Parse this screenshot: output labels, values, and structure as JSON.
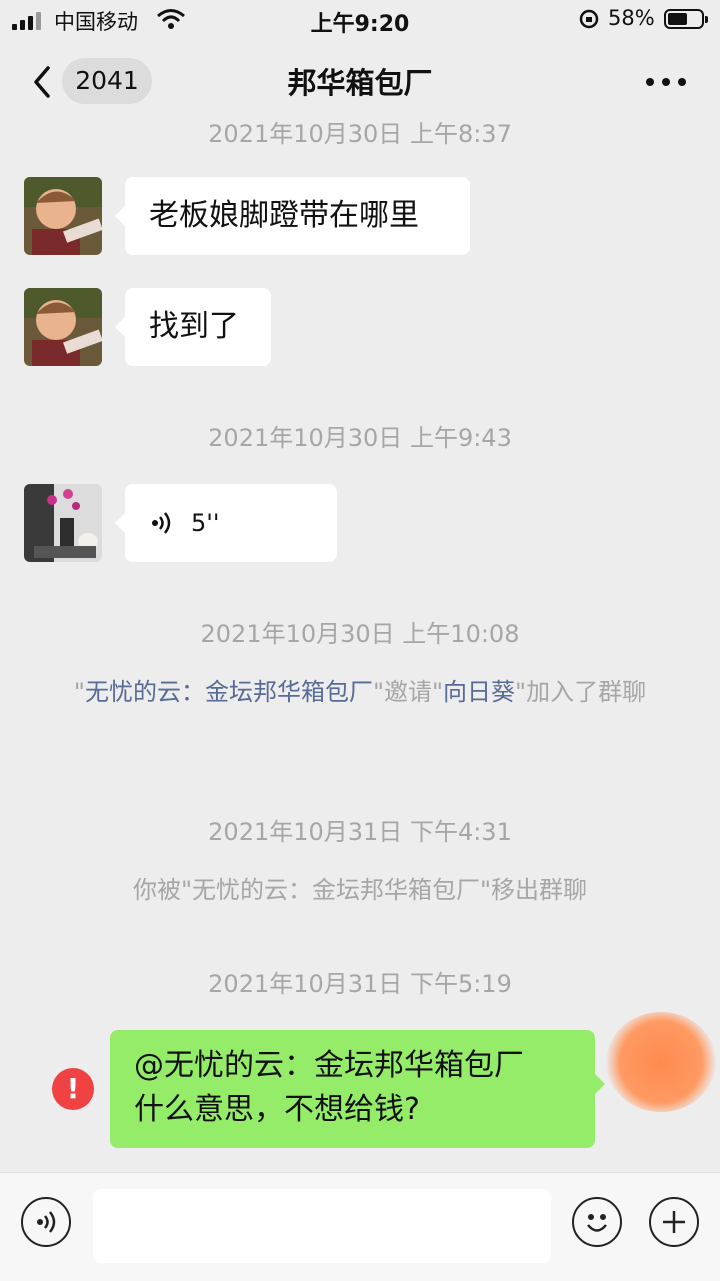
{
  "status_bar": {
    "carrier": "中国移动",
    "time": "上午9:20",
    "battery_percent": "58%",
    "battery_level": 0.58
  },
  "nav": {
    "unread_count": "2041",
    "title": "邦华箱包厂"
  },
  "messages": {
    "cut_timestamp": "2021年10月30日 上午8:37",
    "msg1": "老板娘脚蹬带在哪里",
    "msg2": "找到了",
    "timestamp2": "2021年10月30日 上午9:43",
    "voice_duration": "5''",
    "timestamp3": "2021年10月30日 上午10:08",
    "system_invite": {
      "q1": "\"",
      "inviter": "无忧的云：金坛邦华箱包厂",
      "mid": "\"邀请\"",
      "invitee": "向日葵",
      "tail": "\"加入了群聊"
    },
    "timestamp4": "2021年10月31日 下午4:31",
    "system_removed": "你被\"无忧的云：金坛邦华箱包厂\"移出群聊",
    "timestamp5": "2021年10月31日 下午5:19",
    "sent_line1": "@无忧的云：金坛邦华箱包厂",
    "sent_line2": "什么意思，不想给钱?",
    "error_mark": "!"
  },
  "colors": {
    "background": "#ededed",
    "sent_bubble": "#95ec69",
    "link": "#576b95",
    "error": "#f04242"
  }
}
